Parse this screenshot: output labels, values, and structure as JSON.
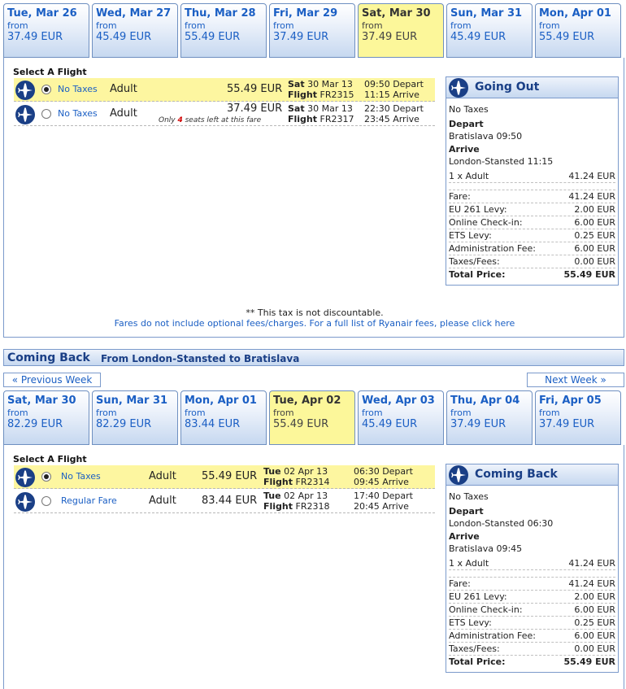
{
  "outbound": {
    "dates": [
      {
        "label": "Tue, Mar 26",
        "from": "from",
        "price_main": "37.",
        "price_cents": "49 EUR",
        "selected": false
      },
      {
        "label": "Wed, Mar 27",
        "from": "from",
        "price_main": "45.",
        "price_cents": "49 EUR",
        "selected": false
      },
      {
        "label": "Thu, Mar 28",
        "from": "from",
        "price_main": "55.",
        "price_cents": "49 EUR",
        "selected": false
      },
      {
        "label": "Fri, Mar 29",
        "from": "from",
        "price_main": "37.",
        "price_cents": "49 EUR",
        "selected": false
      },
      {
        "label": "Sat, Mar 30",
        "from": "from",
        "price_main": "37.",
        "price_cents": "49 EUR",
        "selected": true
      },
      {
        "label": "Sun, Mar 31",
        "from": "from",
        "price_main": "45.",
        "price_cents": "49 EUR",
        "selected": false
      },
      {
        "label": "Mon, Apr 01",
        "from": "from",
        "price_main": "55.",
        "price_cents": "49 EUR",
        "selected": false
      }
    ],
    "select_heading": "Select A Flight",
    "flights": [
      {
        "fare": "No Taxes",
        "pax": "Adult",
        "price": "55.49 EUR",
        "note_pre": "",
        "note_num": "",
        "note_post": "",
        "day": "Sat",
        "date": " 30 Mar 13",
        "flight_label": "Flight",
        "flight_no": " FR2315",
        "dep": "09:50 Depart",
        "arr": "11:15 Arrive",
        "selected": true
      },
      {
        "fare": "No Taxes",
        "pax": "Adult",
        "price": "37.49 EUR",
        "note_pre": "Only ",
        "note_num": "4",
        "note_post": " seats left at this fare",
        "day": "Sat",
        "date": " 30 Mar 13",
        "flight_label": "Flight",
        "flight_no": " FR2317",
        "dep": "22:30 Depart",
        "arr": "23:45 Arrive",
        "selected": false
      }
    ],
    "summary": {
      "title": "Going Out",
      "fare_type": "No Taxes",
      "depart_label": "Depart",
      "depart_value": "Bratislava 09:50",
      "arrive_label": "Arrive",
      "arrive_value": "London-Stansted 11:15",
      "pax_line": {
        "label": "1 x Adult",
        "value": "41.24 EUR"
      },
      "rows": [
        {
          "label": "Fare:",
          "value": "41.24 EUR"
        },
        {
          "label": "EU 261 Levy:",
          "value": "2.00 EUR"
        },
        {
          "label": "Online Check-in:",
          "value": "6.00 EUR"
        },
        {
          "label": "ETS Levy:",
          "value": "0.25 EUR"
        },
        {
          "label": "Administration Fee:",
          "value": "6.00 EUR"
        },
        {
          "label": "Taxes/Fees:",
          "value": "0.00 EUR"
        }
      ],
      "total": {
        "label": "Total Price:",
        "value": "55.49 EUR"
      }
    },
    "note_tax": "** This tax is not discountable.",
    "note_fees": "Fares do not include optional fees/charges. For a full list of Ryanair fees, please click here"
  },
  "return_header": {
    "title": "Coming Back",
    "route": "From London-Stansted to Bratislava"
  },
  "week_nav": {
    "prev": "« Previous Week",
    "next": "Next Week »"
  },
  "inbound": {
    "dates": [
      {
        "label": "Sat, Mar 30",
        "from": "from",
        "price_main": "82.",
        "price_cents": "29 EUR",
        "selected": false
      },
      {
        "label": "Sun, Mar 31",
        "from": "from",
        "price_main": "82.",
        "price_cents": "29 EUR",
        "selected": false
      },
      {
        "label": "Mon, Apr 01",
        "from": "from",
        "price_main": "83.",
        "price_cents": "44 EUR",
        "selected": false
      },
      {
        "label": "Tue, Apr 02",
        "from": "from",
        "price_main": "55.",
        "price_cents": "49 EUR",
        "selected": true
      },
      {
        "label": "Wed, Apr 03",
        "from": "from",
        "price_main": "45.",
        "price_cents": "49 EUR",
        "selected": false
      },
      {
        "label": "Thu, Apr 04",
        "from": "from",
        "price_main": "37.",
        "price_cents": "49 EUR",
        "selected": false
      },
      {
        "label": "Fri, Apr 05",
        "from": "from",
        "price_main": "37.",
        "price_cents": "49 EUR",
        "selected": false
      }
    ],
    "select_heading": "Select A Flight",
    "flights": [
      {
        "fare": "No Taxes",
        "pax": "Adult",
        "price": "55.49 EUR",
        "day": "Tue",
        "date": " 02 Apr 13",
        "flight_label": "Flight",
        "flight_no": " FR2314",
        "dep": "06:30 Depart",
        "arr": "09:45 Arrive",
        "selected": true
      },
      {
        "fare": "Regular Fare",
        "pax": "Adult",
        "price": "83.44 EUR",
        "day": "Tue",
        "date": " 02 Apr 13",
        "flight_label": "Flight",
        "flight_no": " FR2318",
        "dep": "17:40 Depart",
        "arr": "20:45 Arrive",
        "selected": false
      }
    ],
    "summary": {
      "title": "Coming Back",
      "fare_type": "No Taxes",
      "depart_label": "Depart",
      "depart_value": "London-Stansted 06:30",
      "arrive_label": "Arrive",
      "arrive_value": "Bratislava 09:45",
      "pax_line": {
        "label": "1 x Adult",
        "value": "41.24 EUR"
      },
      "rows": [
        {
          "label": "Fare:",
          "value": "41.24 EUR"
        },
        {
          "label": "EU 261 Levy:",
          "value": "2.00 EUR"
        },
        {
          "label": "Online Check-in:",
          "value": "6.00 EUR"
        },
        {
          "label": "ETS Levy:",
          "value": "0.25 EUR"
        },
        {
          "label": "Administration Fee:",
          "value": "6.00 EUR"
        },
        {
          "label": "Taxes/Fees:",
          "value": "0.00 EUR"
        }
      ],
      "total": {
        "label": "Total Price:",
        "value": "55.49 EUR"
      }
    }
  },
  "icons": {
    "flight": "airplane-icon",
    "radio": "radio-button"
  },
  "colors": {
    "link_blue": "#1b5fc4",
    "selected_yellow": "#fcf79a",
    "header_navy": "#1a3f86",
    "warning_red": "#d00000"
  }
}
